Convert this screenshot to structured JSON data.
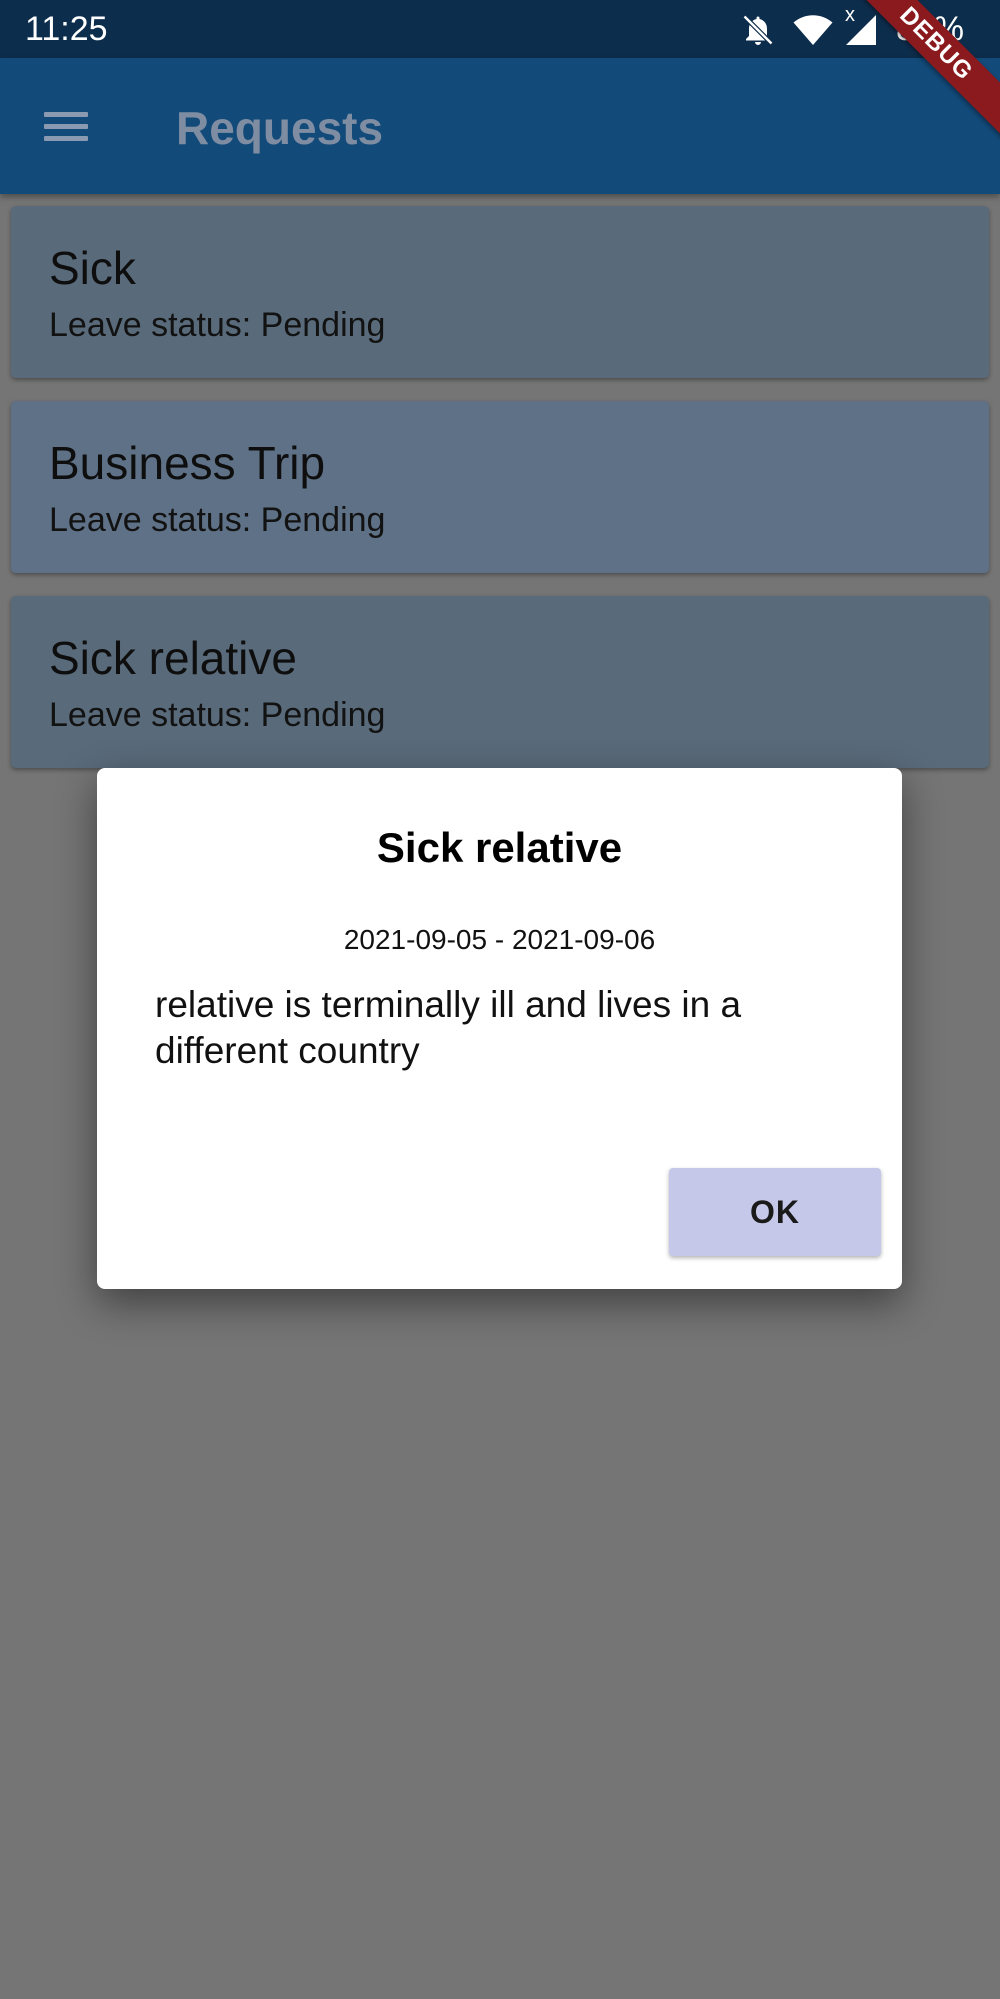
{
  "status_bar": {
    "time": "11:25",
    "battery": "85%",
    "icons": [
      "notifications-off-icon",
      "wifi-icon",
      "signal-no-data-icon"
    ]
  },
  "app_bar": {
    "title": "Requests",
    "menu_icon": "hamburger-menu-icon",
    "debug_banner": "DEBUG"
  },
  "requests": [
    {
      "title": "Sick",
      "status": "Leave status: Pending"
    },
    {
      "title": "Business Trip",
      "status": "Leave status: Pending"
    },
    {
      "title": "Sick relative",
      "status": "Leave status: Pending"
    }
  ],
  "dialog": {
    "title": "Sick relative",
    "dates": "2021-09-05 - 2021-09-06",
    "body": "relative is terminally ill and lives in a different country",
    "ok_label": "OK"
  },
  "colors": {
    "status_bar": "#0d2d4c",
    "app_bar": "#124a79",
    "scrim_background": "#757575",
    "card": "#596a7a",
    "ok_button": "#c5c8e8",
    "debug_banner": "#8b1a1f"
  }
}
